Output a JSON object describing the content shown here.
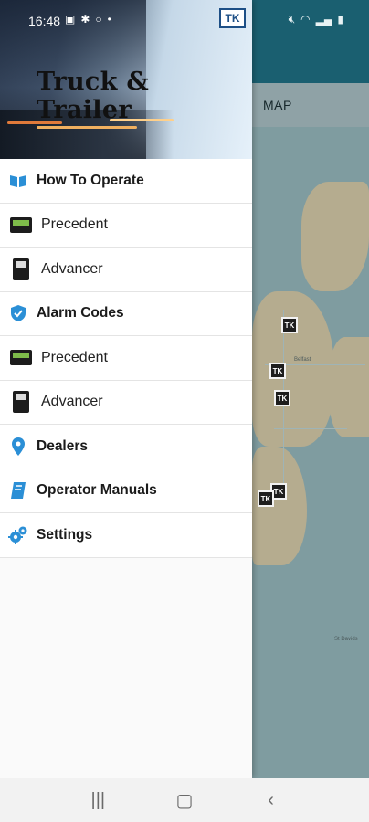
{
  "status_bar": {
    "time": "16:48",
    "left_icons": [
      "gallery-icon",
      "settings-gear-icon",
      "circle-icon",
      "dot-icon"
    ],
    "right_icons": [
      "mute-icon",
      "wifi-icon",
      "signal-icon",
      "battery-icon"
    ]
  },
  "background_app": {
    "tab_label": "MAP",
    "map_pin_label": "TK"
  },
  "drawer": {
    "header_title": "Truck & Trailer",
    "items": [
      {
        "label": "How To Operate",
        "icon": "open-book-icon",
        "type": "section"
      },
      {
        "label": "Precedent",
        "icon": "precedent-unit-icon",
        "type": "sub"
      },
      {
        "label": "Advancer",
        "icon": "advancer-unit-icon",
        "type": "sub"
      },
      {
        "label": "Alarm Codes",
        "icon": "shield-icon",
        "type": "section"
      },
      {
        "label": "Precedent",
        "icon": "precedent-unit-icon",
        "type": "sub"
      },
      {
        "label": "Advancer",
        "icon": "advancer-unit-icon",
        "type": "sub"
      },
      {
        "label": "Dealers",
        "icon": "location-pin-icon",
        "type": "section"
      },
      {
        "label": "Operator Manuals",
        "icon": "manual-book-icon",
        "type": "section"
      },
      {
        "label": "Settings",
        "icon": "gears-icon",
        "type": "section"
      }
    ]
  },
  "nav_bar": {
    "recents_glyph": "|||",
    "home_glyph": "▢",
    "back_glyph": "‹"
  },
  "colors": {
    "accent_blue": "#2b8fd6",
    "app_bar": "#1a5f70"
  }
}
